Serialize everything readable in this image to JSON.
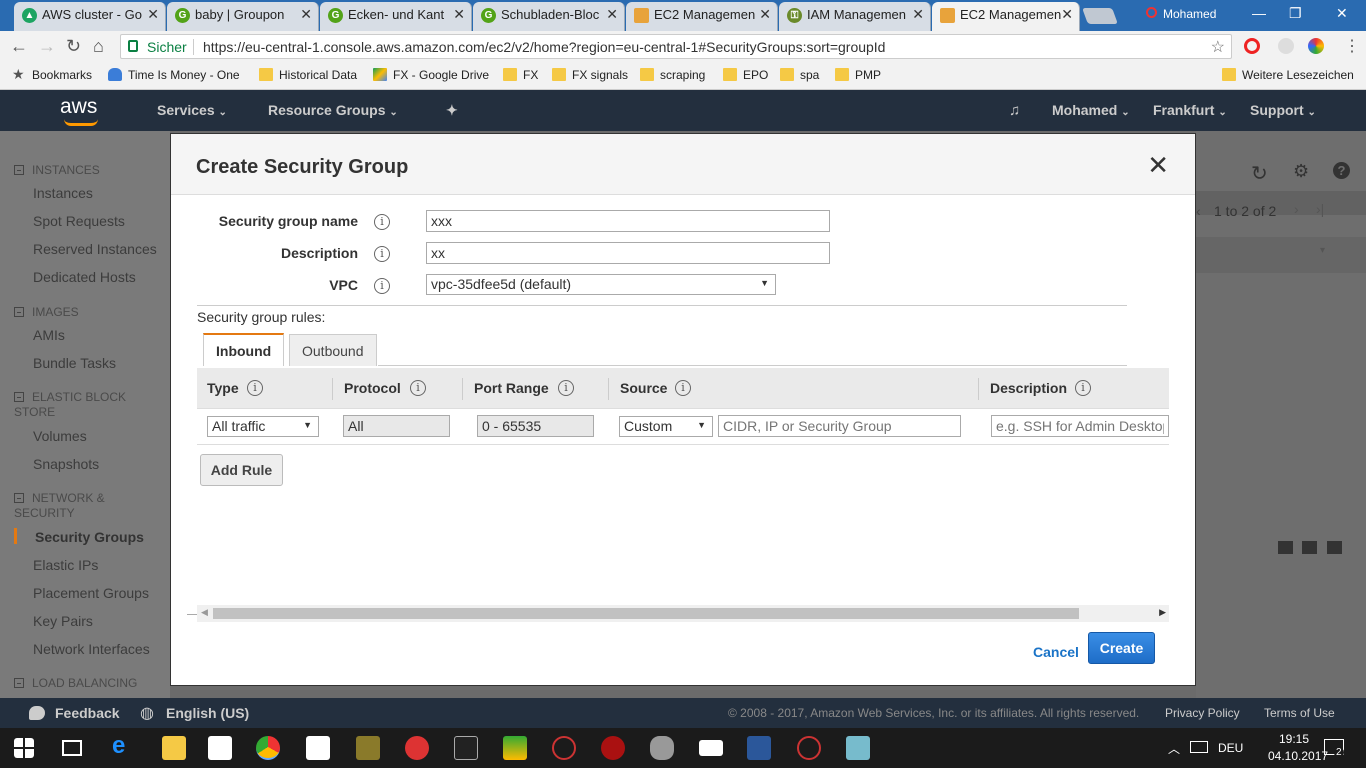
{
  "browser": {
    "tabs": [
      {
        "label": "AWS cluster - Go",
        "icon": "drive-icon",
        "color": "#1da462"
      },
      {
        "label": "baby | Groupon",
        "icon": "groupon-icon",
        "color": "#53a318"
      },
      {
        "label": "Ecken- und Kant",
        "icon": "groupon-icon",
        "color": "#53a318"
      },
      {
        "label": "Schubladen-Bloc",
        "icon": "groupon-icon",
        "color": "#53a318"
      },
      {
        "label": "EC2 Managemen",
        "icon": "aws-box-icon",
        "color": "#e8a33b"
      },
      {
        "label": "IAM Managemen",
        "icon": "key-icon",
        "color": "#6a8a2a"
      },
      {
        "label": "EC2 Managemen",
        "icon": "aws-box-icon",
        "color": "#e8a33b"
      }
    ],
    "user": "Mohamed",
    "secure_label": "Sicher",
    "url": "https://eu-central-1.console.aws.amazon.com/ec2/v2/home?region=eu-central-1#SecurityGroups:sort=groupId",
    "bookmarks": [
      "Bookmarks",
      "Time Is Money - One",
      "Historical Data",
      "FX - Google Drive",
      "FX",
      "FX signals",
      "scraping",
      "EPO",
      "spa",
      "PMP"
    ],
    "more_bookmarks": "Weitere Lesezeichen"
  },
  "aws_header": {
    "logo": "aws",
    "services": "Services",
    "resource_groups": "Resource Groups",
    "account": "Mohamed",
    "region": "Frankfurt",
    "support": "Support"
  },
  "sidebar": {
    "sections": [
      {
        "title": "INSTANCES",
        "items": [
          "Instances",
          "Spot Requests",
          "Reserved Instances",
          "Dedicated Hosts"
        ]
      },
      {
        "title": "IMAGES",
        "items": [
          "AMIs",
          "Bundle Tasks"
        ]
      },
      {
        "title": "ELASTIC BLOCK STORE",
        "items": [
          "Volumes",
          "Snapshots"
        ]
      },
      {
        "title": "NETWORK & SECURITY",
        "items": [
          "Security Groups",
          "Elastic IPs",
          "Placement Groups",
          "Key Pairs",
          "Network Interfaces"
        ]
      },
      {
        "title": "LOAD BALANCING",
        "items": []
      }
    ],
    "active_item": "Security Groups"
  },
  "background": {
    "pagination": "1 to 2 of 2"
  },
  "modal": {
    "title": "Create Security Group",
    "fields": {
      "name_label": "Security group name",
      "name_value": "xxx",
      "description_label": "Description",
      "description_value": "xx",
      "vpc_label": "VPC",
      "vpc_value": "vpc-35dfee5d (default)"
    },
    "rules_label": "Security group rules:",
    "tabs": {
      "inbound": "Inbound",
      "outbound": "Outbound"
    },
    "columns": {
      "type": "Type",
      "protocol": "Protocol",
      "port_range": "Port Range",
      "source": "Source",
      "description": "Description"
    },
    "rule": {
      "type": "All traffic",
      "protocol": "All",
      "port_range": "0 - 65535",
      "source_type": "Custom",
      "source_placeholder": "CIDR, IP or Security Group",
      "description_placeholder": "e.g. SSH for Admin Desktop"
    },
    "add_rule": "Add Rule",
    "cancel": "Cancel",
    "create": "Create"
  },
  "footer": {
    "feedback": "Feedback",
    "language": "English (US)",
    "copyright": "© 2008 - 2017, Amazon Web Services, Inc. or its affiliates. All rights reserved.",
    "privacy": "Privacy Policy",
    "terms": "Terms of Use"
  },
  "taskbar": {
    "language": "DEU",
    "time": "19:15",
    "date": "04.10.2017",
    "notifications": "2"
  }
}
